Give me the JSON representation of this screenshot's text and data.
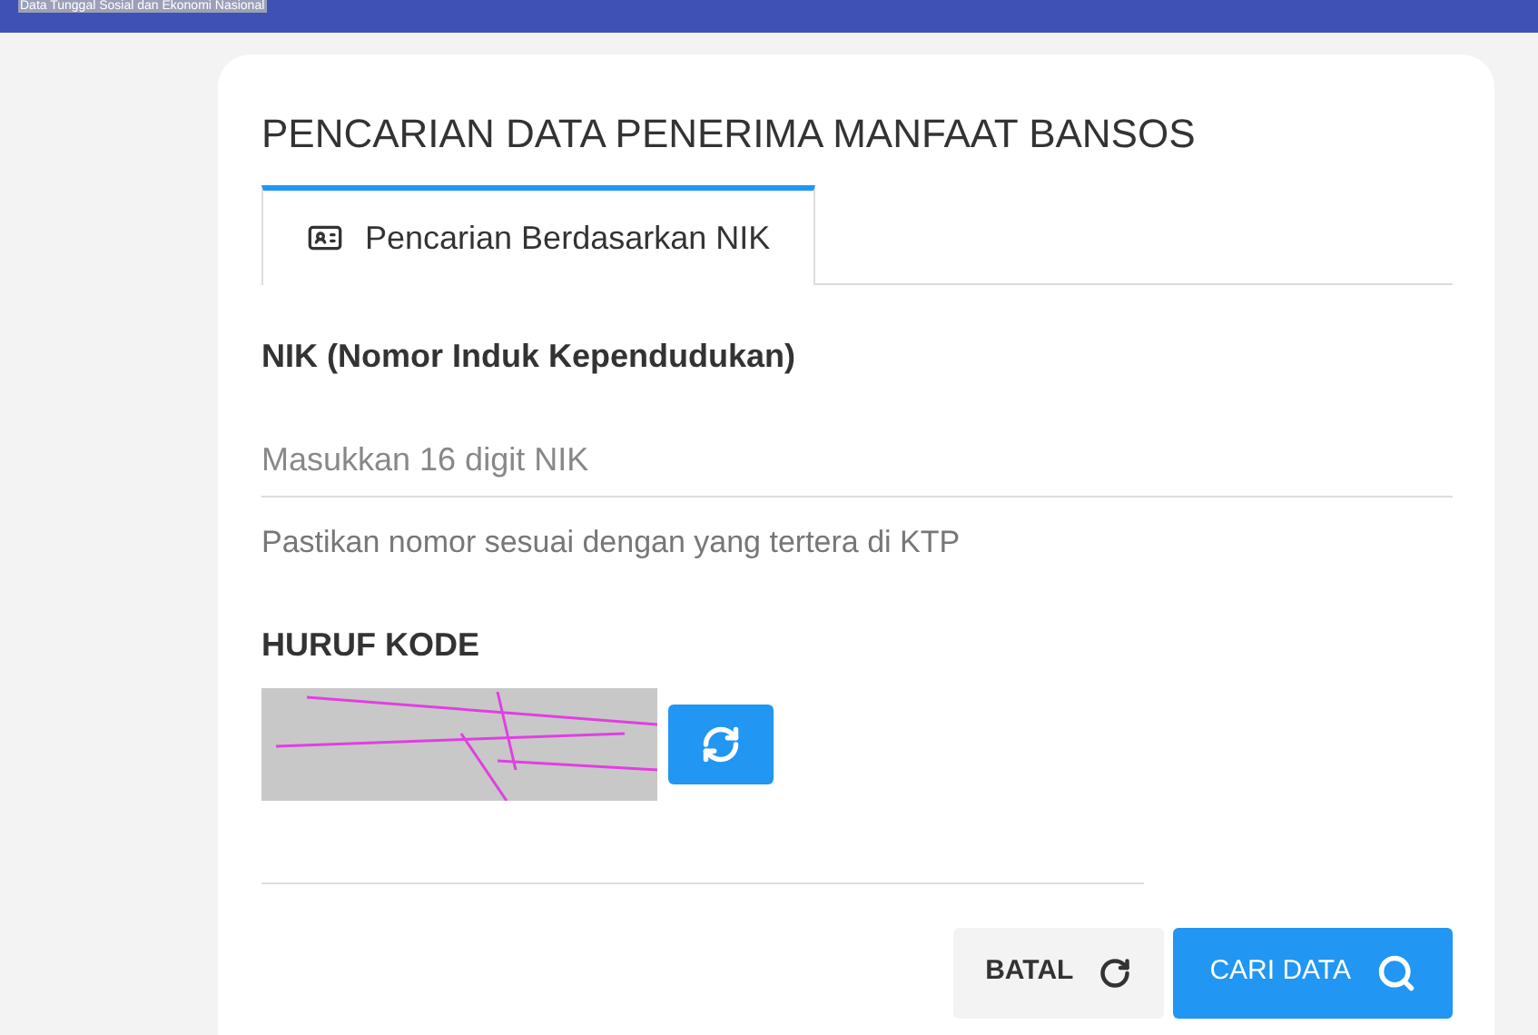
{
  "top_bar": {
    "subtitle": "Data Tunggal Sosial dan Ekonomi Nasional"
  },
  "card": {
    "title": "PENCARIAN DATA PENERIMA MANFAAT BANSOS"
  },
  "tabs": [
    {
      "label": "Pencarian Berdasarkan NIK",
      "selected": true
    }
  ],
  "nik_field": {
    "label": "NIK (Nomor Induk Kependudukan)",
    "placeholder": "Masukkan 16 digit NIK",
    "hint": "Pastikan nomor sesuai dengan yang tertera di KTP"
  },
  "captcha": {
    "label": "HURUF KODE"
  },
  "buttons": [
    {
      "label": "BATAL",
      "kind": "cancel"
    },
    {
      "label": "CARI DATA",
      "kind": "search"
    }
  ]
}
